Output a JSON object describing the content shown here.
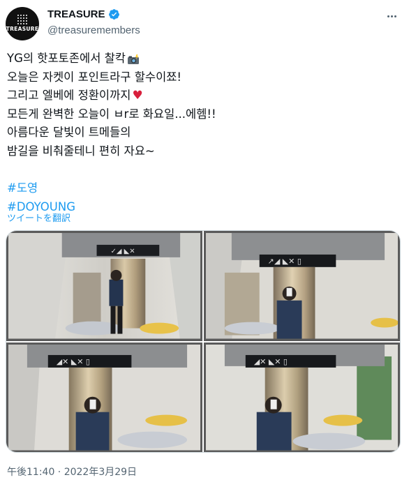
{
  "user": {
    "display_name": "TREASURE",
    "handle": "@treasuremembers",
    "avatar_logo_text": "TREASURE",
    "verified_icon": "verified-badge-icon",
    "more_icon": "more-options-icon"
  },
  "tweet": {
    "lines": [
      "YG의 핫포토존에서 찰칵",
      "오늘은 자켓이 포인트라구 할수이쬬!",
      "그리고 엘베에 정환이까지",
      "모든게 완벽한 오늘이 ㅂr로 화요일...에헴!!",
      "아름다운 달빛이 트메들의",
      "밤길을 비춰줄테니 편히 자요~"
    ],
    "heart_emoji": "♥",
    "hashtags": [
      "#도영",
      "#DOYOUNG"
    ],
    "translate_label": "ツイートを翻訳",
    "timestamp": "午後11:40 · 2022年3月29日"
  },
  "media": {
    "photos": [
      "photo-1",
      "photo-2",
      "photo-3",
      "photo-4"
    ]
  },
  "colors": {
    "link": "#1d9bf0",
    "secondary_text": "#536471",
    "heart": "#d81f3c"
  }
}
